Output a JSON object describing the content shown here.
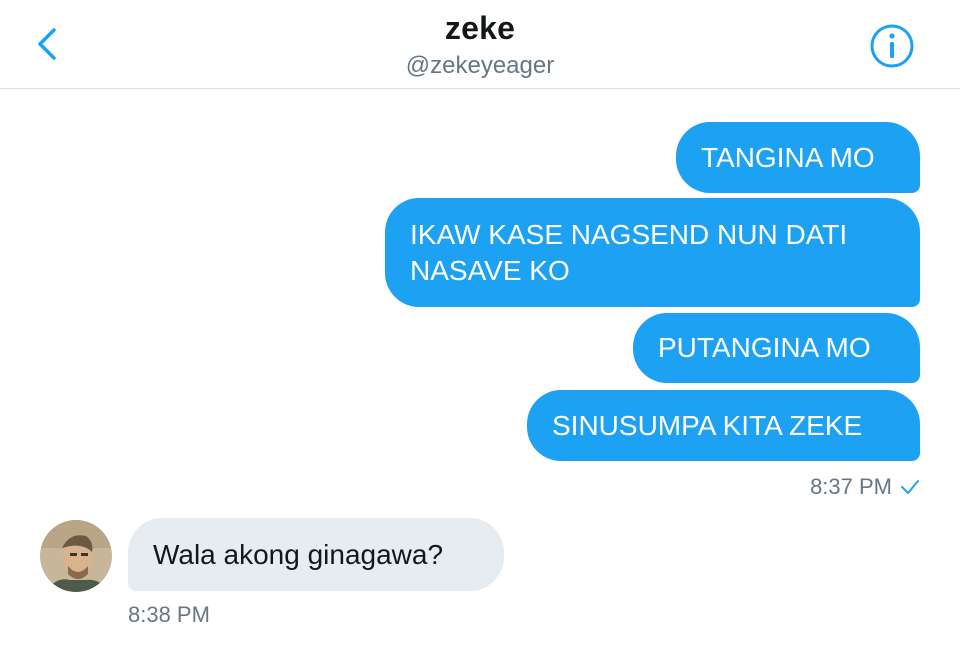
{
  "header": {
    "title": "zeke",
    "handle": "@zekeyeager",
    "back_icon": "chevron-left-icon",
    "info_icon": "info-icon"
  },
  "colors": {
    "accent": "#1da1f2",
    "received_bubble": "#e6ecf0",
    "secondary_text": "#657786"
  },
  "messages": [
    {
      "direction": "sent",
      "text": "TANGINA MO"
    },
    {
      "direction": "sent",
      "text": "IKAW KASE NAGSEND NUN DATI NASAVE KO"
    },
    {
      "direction": "sent",
      "text": "PUTANGINA MO"
    },
    {
      "direction": "sent",
      "text": "SINUSUMPA KITA ZEKE"
    },
    {
      "direction": "received",
      "text": "Wala akong ginagawa?"
    }
  ],
  "sent_group": {
    "timestamp": "8:37 PM",
    "status_icon": "check-icon"
  },
  "received_group": {
    "timestamp": "8:38 PM"
  }
}
